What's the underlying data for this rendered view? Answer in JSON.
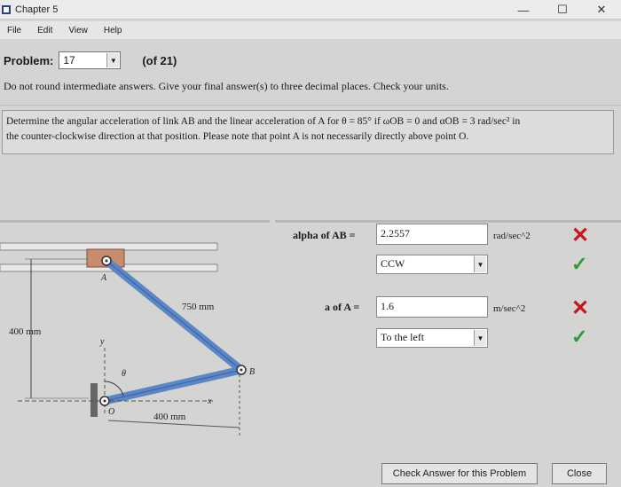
{
  "window": {
    "title": "Chapter 5",
    "controls": {
      "minimize": "—",
      "maximize": "☐",
      "close": "✕"
    }
  },
  "menu": [
    "File",
    "Edit",
    "View",
    "Help"
  ],
  "problem": {
    "label": "Problem:",
    "number": "17",
    "count": "(of 21)"
  },
  "instructions": "Do not round intermediate answers. Give your final answer(s) to three decimal places. Check your units.",
  "question": {
    "line1": "Determine the angular acceleration of link AB and the linear acceleration of A for θ = 85° if ωOB = 0 and αOB = 3 rad/sec² in",
    "line2": "the counter-clockwise direction at that position. Please note that point A is not necessarily directly above point O."
  },
  "diagram": {
    "label_A": "A",
    "label_B": "B",
    "label_O": "O",
    "label_y": "y",
    "label_x": "x",
    "label_theta": "θ",
    "dim_AB": "750 mm",
    "dim_vertical": "400 mm",
    "dim_OB": "400 mm"
  },
  "answers": {
    "alpha_label": "alpha of AB =",
    "alpha_value": "2.2557",
    "alpha_unit": "rad/sec^2",
    "alpha_dir": "CCW",
    "a_label": "a of A =",
    "a_value": "1.6",
    "a_unit": "m/sec^2",
    "a_dir": "To the left"
  },
  "marks": {
    "wrong": "✕",
    "right": "✓"
  },
  "buttons": {
    "check": "Check Answer for this Problem",
    "close": "Close"
  }
}
